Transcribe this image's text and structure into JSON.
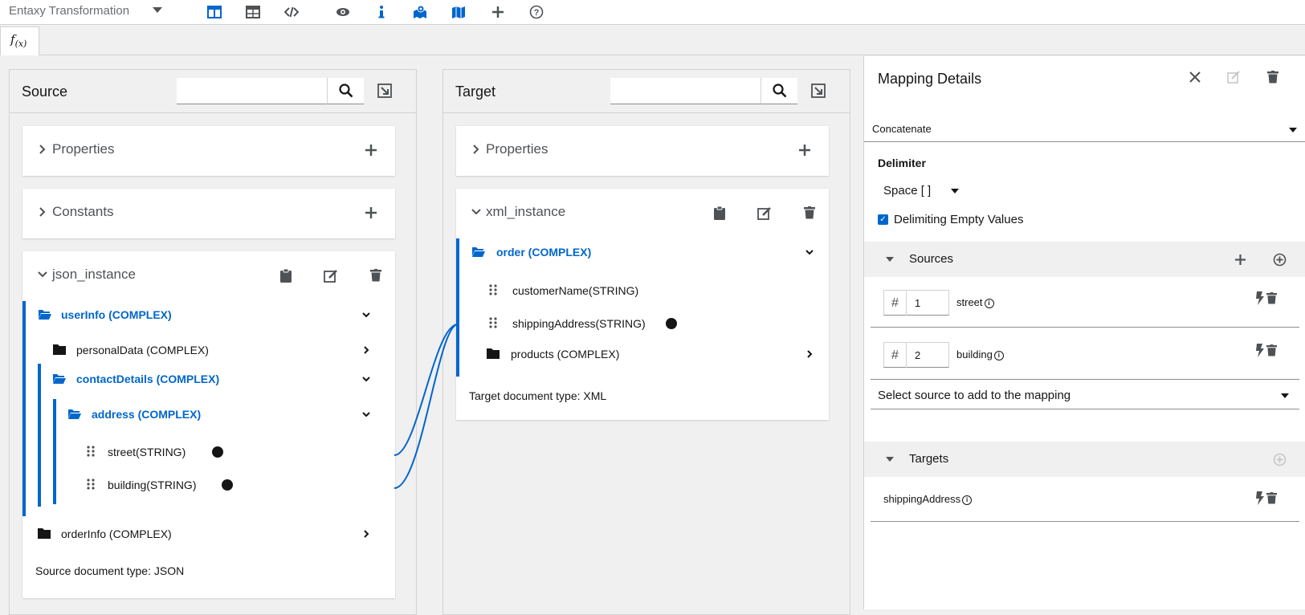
{
  "toolbar": {
    "app_title": "Entaxy Transformation",
    "icons": [
      "columns-icon",
      "table-icon",
      "code-icon",
      "eye-icon",
      "info-icon",
      "map-marked-icon",
      "map-icon",
      "plus-icon",
      "help-icon"
    ],
    "accent_color": "#0066cc"
  },
  "fx_tab": {
    "label": "f",
    "sub": "(x)"
  },
  "source": {
    "title": "Source",
    "search_placeholder": "",
    "properties_label": "Properties",
    "constants_label": "Constants",
    "instance_label": "json_instance",
    "tree": {
      "userInfo": "userInfo (COMPLEX)",
      "personalData": "personalData (COMPLEX)",
      "contactDetails": "contactDetails (COMPLEX)",
      "address": "address (COMPLEX)",
      "street": "street(STRING)",
      "building": "building(STRING)",
      "orderInfo": "orderInfo (COMPLEX)"
    },
    "doc_type": "Source document type: JSON"
  },
  "target": {
    "title": "Target",
    "search_placeholder": "",
    "properties_label": "Properties",
    "instance_label": "xml_instance",
    "tree": {
      "order": "order (COMPLEX)",
      "customerName": "customerName(STRING)",
      "shippingAddress": "shippingAddress(STRING)",
      "products": "products (COMPLEX)"
    },
    "doc_type": "Target document type: XML"
  },
  "details": {
    "title": "Mapping Details",
    "transformation": "Concatenate",
    "delimiter_label": "Delimiter",
    "delimiter_value": "Space [ ]",
    "delimiting_empty_label": "Delimiting Empty Values",
    "delimiting_empty_checked": true,
    "sources_label": "Sources",
    "sources": [
      {
        "index": "1",
        "name": "street"
      },
      {
        "index": "2",
        "name": "building"
      }
    ],
    "select_source_placeholder": "Select source to add to the mapping",
    "targets_label": "Targets",
    "targets": [
      {
        "name": "shippingAddress"
      }
    ]
  }
}
